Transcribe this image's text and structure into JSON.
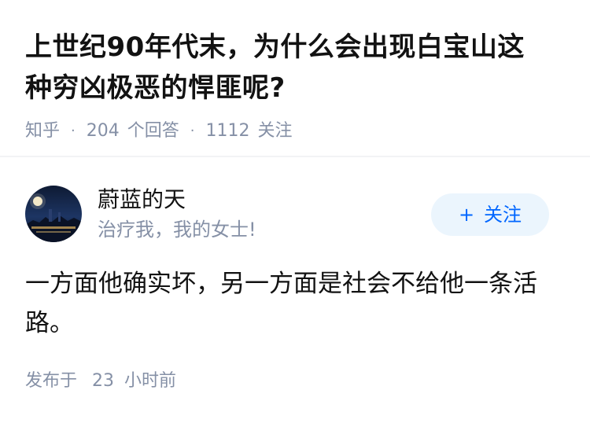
{
  "question": {
    "title_line1": "上世纪90年代末，为什么会出现白宝山这",
    "title_line2": "种穷凶极恶的悍匪呢?",
    "source": "知乎",
    "answer_count": "204",
    "answer_label": "个回答",
    "follower_count": "1112",
    "follower_label": "关注"
  },
  "author": {
    "name": "蔚蓝的天",
    "bio": "治疗我，我的女士!",
    "follow_label": "关注",
    "follow_icon": "plus-icon"
  },
  "answer": {
    "line1": "一方面他确实坏，另一方面是社会不给他一条活",
    "line2": "路。"
  },
  "footer": {
    "posted_label": "发布于",
    "posted_value": "23",
    "posted_unit": "小时前"
  },
  "colors": {
    "text_primary": "#121212",
    "text_secondary": "#8590a6",
    "accent": "#0066ff",
    "follow_bg": "#ebf5fd",
    "divider": "#f2f3f5"
  }
}
